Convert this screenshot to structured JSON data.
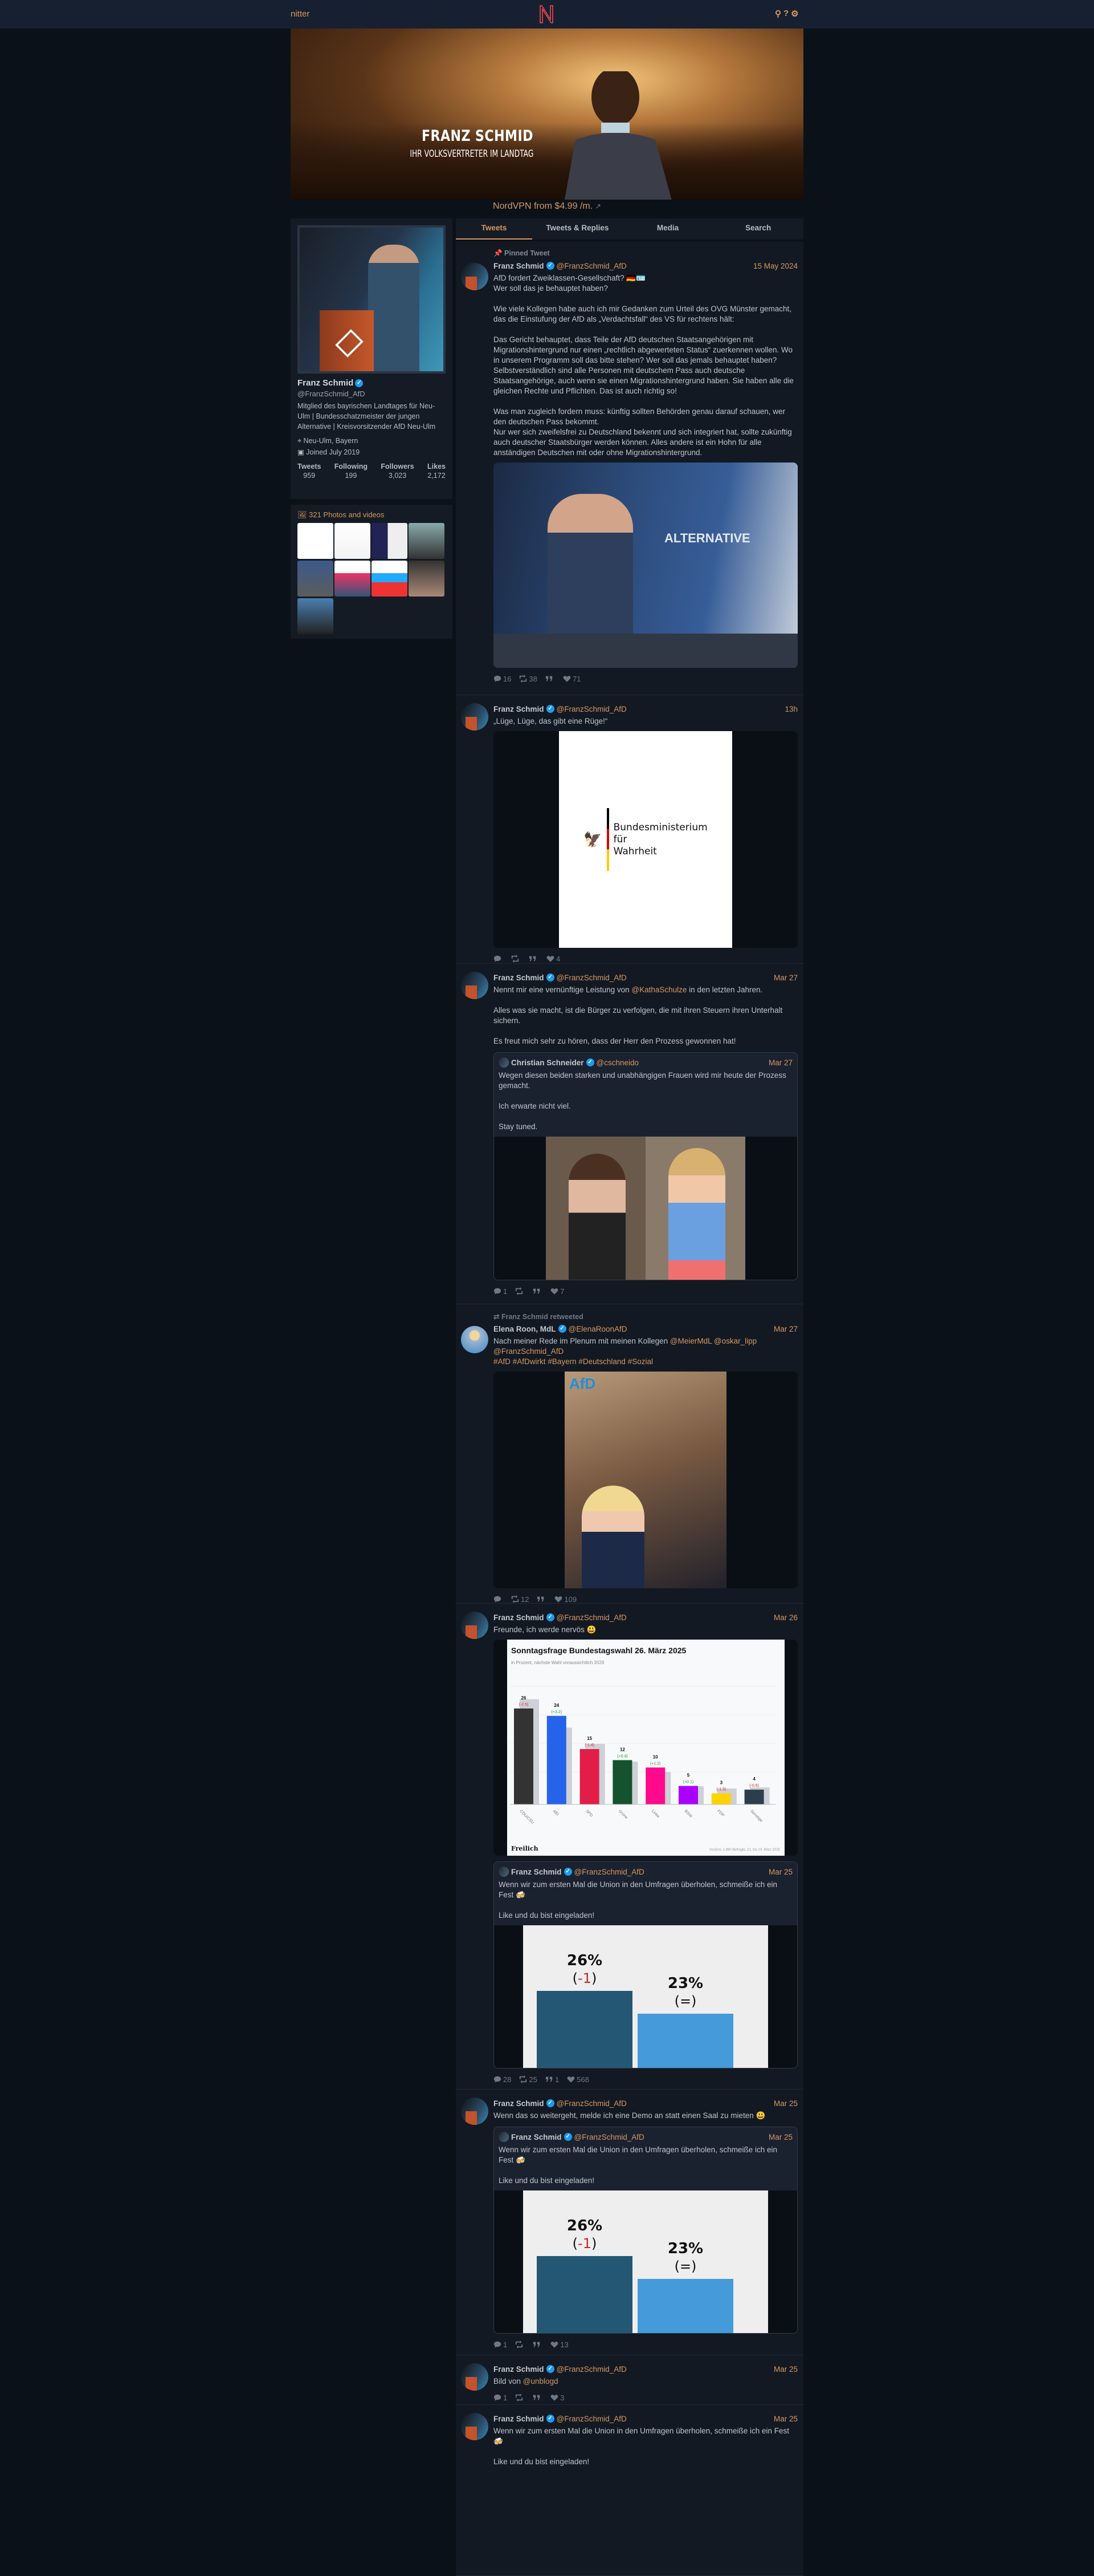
{
  "nav": {
    "brand": "nitter",
    "logo": "N",
    "icons": [
      "search-icon",
      "help-icon",
      "settings-icon"
    ],
    "search": "⚲",
    "help": "?",
    "settings": "⚙"
  },
  "banner": {
    "title": "FRANZ SCHMID",
    "subtitle": "IHR VOLKSVERTRETER IM LANDTAG"
  },
  "ad": {
    "text": "NordVPN from $4.99 /m.",
    "icon": "external-link-icon"
  },
  "profile": {
    "name": "Franz Schmid",
    "handle": "@FranzSchmid_AfD",
    "bio": "Mitglied des bayrischen Landtages für Neu-Ulm | Bundesschatzmeister der jungen Alternative | Kreisvorsitzender AfD Neu-Ulm",
    "location": "Neu-Ulm, Bayern",
    "joined": "Joined July 2019",
    "stats": [
      {
        "label": "Tweets",
        "value": "959"
      },
      {
        "label": "Following",
        "value": "199"
      },
      {
        "label": "Followers",
        "value": "3,023"
      },
      {
        "label": "Likes",
        "value": "2,172"
      }
    ],
    "photos_label": "321 Photos and videos"
  },
  "tabs": [
    {
      "label": "Tweets",
      "active": true
    },
    {
      "label": "Tweets & Replies"
    },
    {
      "label": "Media"
    },
    {
      "label": "Search"
    }
  ],
  "colors": {
    "accent": "#d8975f",
    "background": "#0b1118",
    "panel": "#141b25",
    "verified": "#1d9bf0"
  },
  "tweets": [
    {
      "pinned": "Pinned Tweet",
      "name": "Franz Schmid",
      "handle": "@FranzSchmid_AfD",
      "date": "15 May 2024",
      "text": [
        "AfD fordert Zweiklassen-Gesellschaft? 🇩🇪🪪\nWer soll das je behauptet haben?\n\nWie viele Kollegen habe auch ich mir Gedanken zum Urteil des OVG Münster gemacht, das die Einstufung der AfD als „Verdachtsfall“ des VS für rechtens hält:\n\nDas Gericht behauptet, dass Teile der AfD deutschen Staatsangehörigen mit Migrationshintergrund nur einen „rechtlich abgewerteten Status“ zuerkennen wollen. Wo in unserem Programm soll das bitte stehen? Wer soll das jemals behauptet haben?\nSelbstverständlich sind alle Personen mit deutschem Pass auch deutsche Staatsangehörige, auch wenn sie einen Migrationshintergrund haben. Sie haben alle die gleichen Rechte und Pflichten. Das ist auch richtig so!\n\nWas man zugleich fordern muss: künftig sollten Behörden genau darauf schauen, wer den deutschen Pass bekommt.\nNur wer sich zweifelsfrei zu Deutschland bekennt und sich integriert hat, sollte zukünftig auch deutscher Staatsbürger werden können. Alles andere ist ein Hohn für alle anständigen Deutschen mit oder ohne Migrationshintergrund."
      ],
      "media": {
        "kind": "photo-speaker",
        "banner_text": "ALTERNATIVE"
      },
      "stats": {
        "replies": "16",
        "retweets": "38",
        "quotes": "",
        "likes": "71"
      }
    },
    {
      "name": "Franz Schmid",
      "handle": "@FranzSchmid_AfD",
      "date": "13h",
      "text": [
        "„Lüge, Lüge, das gibt eine Rüge!“"
      ],
      "media": {
        "kind": "ministry",
        "lines": [
          "Bundesministerium",
          "für",
          "Wahrheit"
        ]
      },
      "stats": {
        "replies": "",
        "retweets": "",
        "quotes": "",
        "likes": "4"
      }
    },
    {
      "name": "Franz Schmid",
      "handle": "@FranzSchmid_AfD",
      "date": "Mar 27",
      "text": [
        "Nennt mir eine vernünftige Leistung von ",
        "@KathaSchulze",
        " in den letzten Jahren.\n\nAlles was sie macht, ist die Bürger zu verfolgen, die mit ihren Steuern ihren Unterhalt sichern.\n\nEs freut mich sehr zu hören, dass der Herr den Prozess gewonnen hat!"
      ],
      "quote": {
        "name": "Christian Schneider",
        "handle": "@cschneido",
        "date": "Mar 27",
        "text": [
          "Wegen diesen beiden starken und unabhängigen Frauen wird mir heute der Prozess gemacht.\n\nIch erwarte nicht viel.\n\nStay tuned."
        ],
        "media": {
          "kind": "two-women"
        }
      },
      "stats": {
        "replies": "1",
        "retweets": "",
        "quotes": "",
        "likes": "7"
      }
    },
    {
      "retweeted_by": "Franz Schmid retweeted",
      "name": "Elena Roon, MdL",
      "handle": "@ElenaRoonAfD",
      "date": "Mar 27",
      "avatar": "elena",
      "text": [
        "Nach meiner Rede im Plenum mit meinen Kollegen ",
        "@MeierMdL",
        " ",
        "@oskar_lipp",
        "\n",
        "@FranzSchmid_AfD",
        "\n",
        "#AfD",
        " ",
        "#AfDwirkt",
        " ",
        "#Bayern",
        " ",
        "#Deutschland",
        " ",
        "#Sozial"
      ],
      "media": {
        "kind": "selfie",
        "logo": "AfD"
      },
      "stats": {
        "replies": "",
        "retweets": "12",
        "quotes": "",
        "likes": "109"
      }
    },
    {
      "name": "Franz Schmid",
      "handle": "@FranzSchmid_AfD",
      "date": "Mar 26",
      "text": [
        "Freunde, ich werde nervös 😃"
      ],
      "media": {
        "kind": "poll-chart"
      },
      "quote": {
        "name": "Franz Schmid",
        "handle": "@FranzSchmid_AfD",
        "date": "Mar 25",
        "text": [
          "Wenn wir zum ersten Mal die Union in den Umfragen überholen, schmeiße ich ein Fest 🍻\n\nLike und du bist eingeladen!"
        ],
        "media": {
          "kind": "poll-two",
          "bars": [
            {
              "value": "26%",
              "change": "-1"
            },
            {
              "value": "23%",
              "change": "="
            }
          ]
        }
      },
      "stats": {
        "replies": "28",
        "retweets": "25",
        "quotes": "1",
        "likes": "568"
      }
    },
    {
      "name": "Franz Schmid",
      "handle": "@FranzSchmid_AfD",
      "date": "Mar 25",
      "text": [
        "Wenn das so weitergeht, melde ich eine Demo an statt einen Saal zu mieten 😃"
      ],
      "quote": {
        "name": "Franz Schmid",
        "handle": "@FranzSchmid_AfD",
        "date": "Mar 25",
        "text": [
          "Wenn wir zum ersten Mal die Union in den Umfragen überholen, schmeiße ich ein Fest 🍻\n\nLike und du bist eingeladen!"
        ],
        "media": {
          "kind": "poll-two",
          "bars": [
            {
              "value": "26%",
              "change": "-1"
            },
            {
              "value": "23%",
              "change": "="
            }
          ]
        }
      },
      "stats": {
        "replies": "1",
        "retweets": "",
        "quotes": "",
        "likes": "13"
      }
    },
    {
      "name": "Franz Schmid",
      "handle": "@FranzSchmid_AfD",
      "date": "Mar 25",
      "text": [
        "Bild von ",
        "@unblogd"
      ],
      "stats": {
        "replies": "1",
        "retweets": "",
        "quotes": "",
        "likes": "3"
      }
    },
    {
      "name": "Franz Schmid",
      "handle": "@FranzSchmid_AfD",
      "date": "Mar 25",
      "text": [
        "Wenn wir zum ersten Mal die Union in den Umfragen überholen, schmeiße ich ein Fest 🍻\n\nLike und du bist eingeladen!"
      ]
    }
  ],
  "chart_data": {
    "type": "bar",
    "title": "Sonntagsfrage Bundestagswahl 26. März 2025",
    "subtitle": "in Prozent, nächste Wahl voraussichtlich 2029",
    "categories": [
      "CDU/CSU",
      "AfD",
      "SPD",
      "Grüne",
      "Linke",
      "BSW",
      "FDP",
      "Sonstige"
    ],
    "values": [
      26,
      24,
      15,
      12,
      10,
      5,
      3,
      4
    ],
    "changes": [
      "(-2.5)",
      "(+3.2)",
      "(-1.4)",
      "(+0.4)",
      "(+1.2)",
      "(+0.1)",
      "(-1.3)",
      "(-0.6)"
    ],
    "previous": [
      28.5,
      20.8,
      16.4,
      11.6,
      8.8,
      4.9,
      4.3,
      4.6
    ],
    "colors": [
      "#333333",
      "#2563eb",
      "#e11d48",
      "#14532d",
      "#ff0a8c",
      "#aa00ff",
      "#ffd400",
      "#2c3e4c"
    ],
    "ylim": [
      0,
      32
    ],
    "brand": "Freilich",
    "source": "YouGov, 1.890 Befragte, 21. bis 24. März 2025"
  }
}
